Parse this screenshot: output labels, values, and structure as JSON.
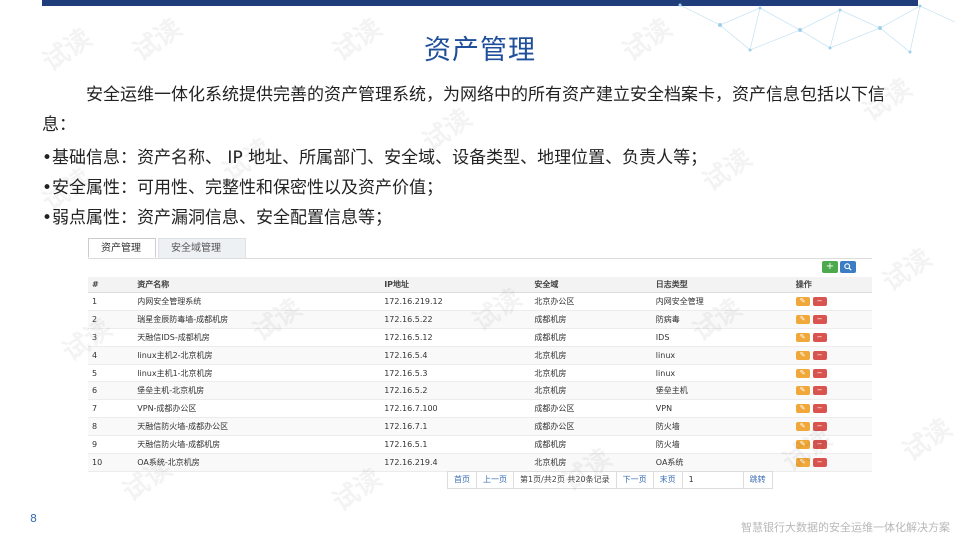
{
  "slide": {
    "title": "资产管理",
    "intro": "安全运维一体化系统提供完善的资产管理系统，为网络中的所有资产建立安全档案卡，资产信息包括以下信息：",
    "bullets": [
      "•基础信息：资产名称、 IP 地址、所属部门、安全域、设备类型、地理位置、负责人等；",
      "•安全属性：可用性、完整性和保密性以及资产价值；",
      "•弱点属性：资产漏洞信息、安全配置信息等；"
    ],
    "page_number": "8",
    "footer": "智慧银行大数据的安全运维一体化解决方案",
    "watermark": "试读"
  },
  "app": {
    "tabs": [
      "资产管理",
      "安全域管理"
    ],
    "tool_icons": [
      "plus-icon",
      "search-icon"
    ],
    "columns": [
      "#",
      "资产名称",
      "IP地址",
      "安全域",
      "日志类型",
      "操作"
    ],
    "rows": [
      [
        "1",
        "内网安全管理系统",
        "172.16.219.12",
        "北京办公区",
        "内网安全管理"
      ],
      [
        "2",
        "瑞星金辰防毒墙-成都机房",
        "172.16.5.22",
        "成都机房",
        "防病毒"
      ],
      [
        "3",
        "天融信IDS-成都机房",
        "172.16.5.12",
        "成都机房",
        "IDS"
      ],
      [
        "4",
        "linux主机2-北京机房",
        "172.16.5.4",
        "北京机房",
        "linux"
      ],
      [
        "5",
        "linux主机1-北京机房",
        "172.16.5.3",
        "北京机房",
        "linux"
      ],
      [
        "6",
        "堡垒主机-北京机房",
        "172.16.5.2",
        "北京机房",
        "堡垒主机"
      ],
      [
        "7",
        "VPN-成都办公区",
        "172.16.7.100",
        "成都办公区",
        "VPN"
      ],
      [
        "8",
        "天融信防火墙-成都办公区",
        "172.16.7.1",
        "成都办公区",
        "防火墙"
      ],
      [
        "9",
        "天融信防火墙-成都机房",
        "172.16.5.1",
        "成都机房",
        "防火墙"
      ],
      [
        "10",
        "OA系统-北京机房",
        "172.16.219.4",
        "北京机房",
        "OA系统"
      ]
    ],
    "pagination": {
      "first": "首页",
      "prev": "上一页",
      "info": "第1页/共2页 共20条记录",
      "next": "下一页",
      "last": "末页",
      "page_input": "1",
      "go": "跳转"
    }
  },
  "colors": {
    "title": "#1f4e9a",
    "bar": "#1f3d7a",
    "add": "#4caa4c",
    "search": "#3b7dc4",
    "edit": "#f0a83a",
    "delete": "#d9534f"
  }
}
